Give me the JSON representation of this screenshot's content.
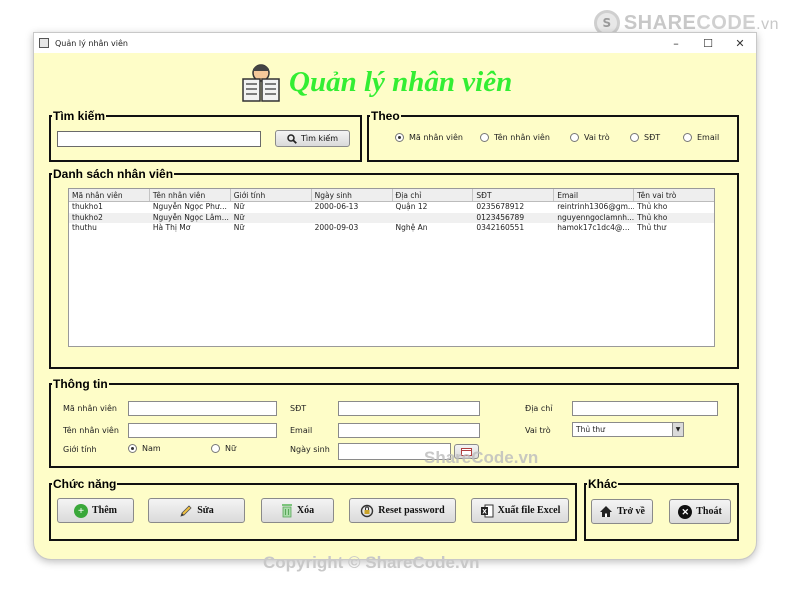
{
  "watermark": {
    "brand_share": "SHARE",
    "brand_code": "CODE",
    "brand_tld": ".vn",
    "middle": "ShareCode.vn",
    "bottom": "Copyright © ShareCode.vn"
  },
  "window": {
    "title": "Quản lý nhân viên",
    "minimize": "–",
    "maximize": "☐",
    "close": "✕"
  },
  "header": {
    "title": "Quản lý nhân viên",
    "icon": "newspaper-reader-icon"
  },
  "search": {
    "legend": "Tìm kiếm",
    "input_value": "",
    "button_label": "Tìm kiếm"
  },
  "filter": {
    "legend": "Theo",
    "options": [
      {
        "label": "Mã nhân viên",
        "selected": true
      },
      {
        "label": "Tên nhân viên",
        "selected": false
      },
      {
        "label": "Vai trò",
        "selected": false
      },
      {
        "label": "SĐT",
        "selected": false
      },
      {
        "label": "Email",
        "selected": false
      }
    ]
  },
  "list": {
    "legend": "Danh sách nhân viên",
    "columns": [
      "Mã nhân viên",
      "Tên nhân viên",
      "Giới tính",
      "Ngày sinh",
      "Địa chỉ",
      "SĐT",
      "Email",
      "Tên vai trò"
    ],
    "rows": [
      [
        "thukho1",
        "Nguyễn Ngọc Phư...",
        "Nữ",
        "2000-06-13",
        "Quận 12",
        "0235678912",
        "reintrinh1306@gm...",
        "Thủ kho"
      ],
      [
        "thukho2",
        "Nguyễn Ngọc Lâm...",
        "Nữ",
        "",
        "",
        "0123456789",
        "nguyenngoclamnh...",
        "Thủ kho"
      ],
      [
        "thuthu",
        "Hà Thị Mơ",
        "Nữ",
        "2000-09-03",
        "Nghệ An",
        "0342160551",
        "hamok17c1dc4@...",
        "Thủ thư"
      ]
    ]
  },
  "info": {
    "legend": "Thông tin",
    "ma_nv_label": "Mã nhân viên",
    "ma_nv_value": "",
    "ten_nv_label": "Tên nhân viên",
    "ten_nv_value": "",
    "gioi_tinh_label": "Giới tính",
    "gender_male": "Nam",
    "gender_female": "Nữ",
    "sdt_label": "SĐT",
    "sdt_value": "",
    "email_label": "Email",
    "email_value": "",
    "ngay_sinh_label": "Ngày sinh",
    "ngay_sinh_value": "",
    "dia_chi_label": "Địa chỉ",
    "dia_chi_value": "",
    "vai_tro_label": "Vai trò",
    "vai_tro_value": "Thủ thư"
  },
  "functions": {
    "legend": "Chức năng",
    "add": "Thêm",
    "edit": "Sửa",
    "delete": "Xóa",
    "reset": "Reset password",
    "export": "Xuất file Excel"
  },
  "other": {
    "legend": "Khác",
    "back": "Trở về",
    "exit": "Thoát"
  },
  "colors": {
    "window_bg": "#fefdc8",
    "title_green": "#33ee33"
  }
}
